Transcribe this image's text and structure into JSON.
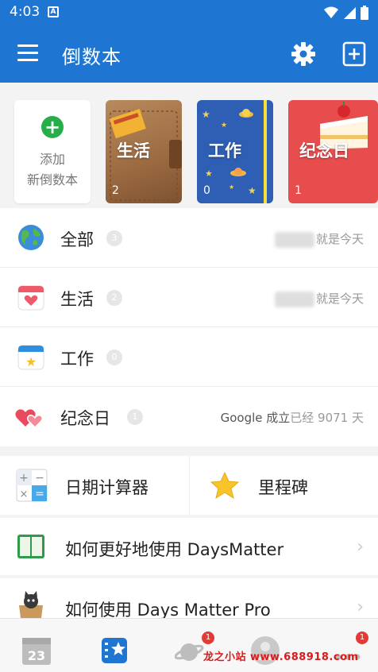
{
  "status_bar": {
    "time": "4:03",
    "notification_icon": "A"
  },
  "app_bar": {
    "title": "倒数本",
    "settings_icon": "gear-icon",
    "add_book_icon": "add-book-icon"
  },
  "books": {
    "add": {
      "line1": "添加",
      "line2": "新倒数本"
    },
    "items": [
      {
        "name": "生活",
        "count": "2"
      },
      {
        "name": "工作",
        "count": "0"
      },
      {
        "name": "纪念日",
        "count": "1"
      }
    ]
  },
  "categories": [
    {
      "name": "全部",
      "count": "3",
      "right": "就是今天"
    },
    {
      "name": "生活",
      "count": "2",
      "right": "就是今天"
    },
    {
      "name": "工作",
      "count": "0",
      "right": ""
    },
    {
      "name": "纪念日",
      "count": "1",
      "right_prefix": "Google 成立",
      "right": "已经 9071 天"
    }
  ],
  "tools": {
    "date_calc": "日期计算器",
    "milestone": "里程碑"
  },
  "guides": [
    {
      "label": "如何更好地使用 DaysMatter"
    },
    {
      "label": "如何使用 Days Matter Pro"
    }
  ],
  "bottom_nav": {
    "calendar_day": "23",
    "badge_1": "1",
    "badge_2": "1"
  },
  "watermark": "龙之小站 www.688918.com",
  "colors": {
    "primary": "#1f76d2",
    "green": "#27ae4a",
    "red": "#e84d4d"
  }
}
